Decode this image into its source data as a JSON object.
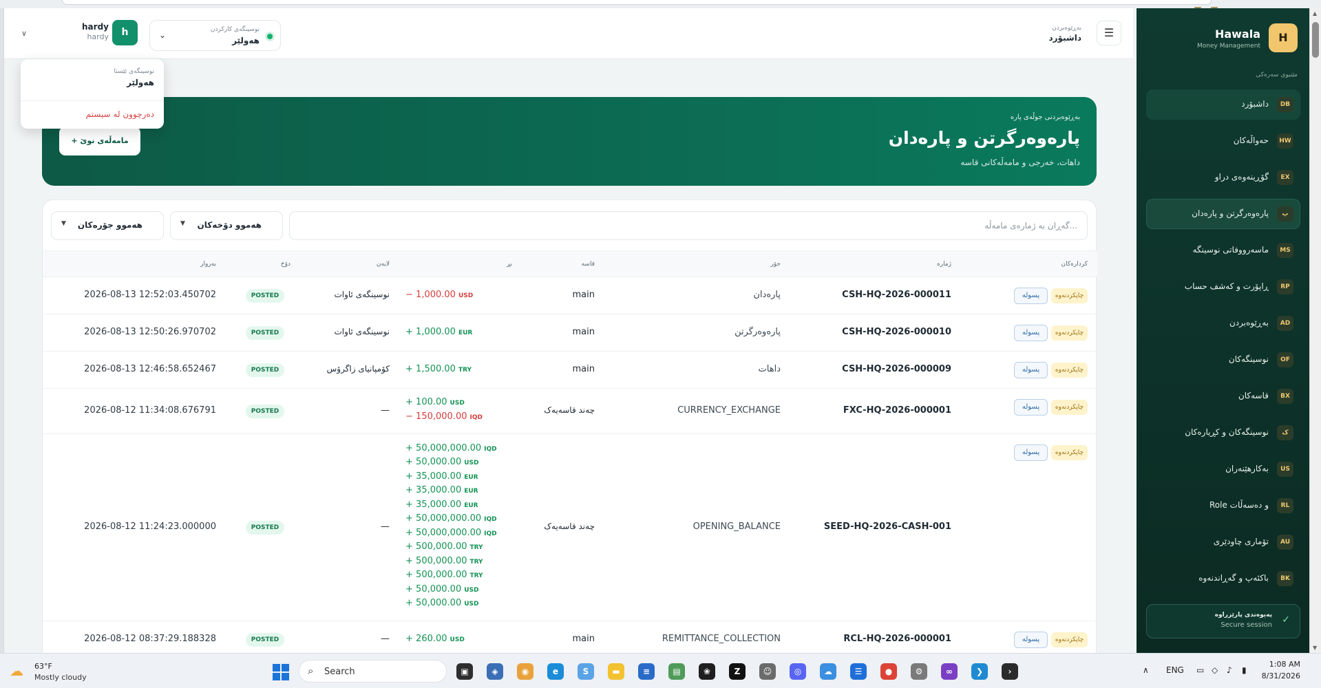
{
  "header": {
    "user_name": "hardy",
    "user_sub": "hardy",
    "user_initial": "h",
    "office_label": "نوسینگەی کارکردن",
    "office_value": "هەولێر",
    "crumb_top": "بەڕێوەبردن",
    "crumb_title": "داشبۆرد"
  },
  "dropdown": {
    "office_label": "نوسینگەی ئێستا",
    "office_value": "هەولێر",
    "logout": "دەرچوون لە سیستم"
  },
  "hero": {
    "kicker": "بەڕێوەبردنی جوڵەی پارە",
    "title": "پارەوەرگرتن و پارەدان",
    "subtitle": "داهات، خەرجی و مامەڵەکانی قاسە",
    "new_button": "+  مامەڵەی نوێ"
  },
  "filters": {
    "search_placeholder": "گەڕان بە ژمارەی مامەڵە...",
    "filter_types": "هەموو دۆخەکان",
    "filter_kinds": "هەموو جۆرەکان"
  },
  "table": {
    "headers": {
      "actions": "کردارەکان",
      "number": "ژمارە",
      "type": "جۆر",
      "cashbox": "قاسە",
      "amount": "بڕ",
      "party": "لایەن",
      "status": "دۆخ",
      "date": "بەروار"
    },
    "posting_label": "پسولە",
    "print_label": "چاپکردنەوە",
    "rows": [
      {
        "ref": "CSH-HQ-2026-000011",
        "type": "پارەدان",
        "cashbox": "main",
        "amounts": [
          {
            "sign": "−",
            "value": "1,000.00",
            "cur": "USD",
            "neg": true
          }
        ],
        "party": "نوسینگەی ئاوات",
        "status": "POSTED",
        "date": "2026-08-13 12:52:03.450702"
      },
      {
        "ref": "CSH-HQ-2026-000010",
        "type": "پارەوەرگرتن",
        "cashbox": "main",
        "amounts": [
          {
            "sign": "+",
            "value": "1,000.00",
            "cur": "EUR",
            "neg": false
          }
        ],
        "party": "نوسینگەی ئاوات",
        "status": "POSTED",
        "date": "2026-08-13 12:50:26.970702"
      },
      {
        "ref": "CSH-HQ-2026-000009",
        "type": "داهات",
        "cashbox": "main",
        "amounts": [
          {
            "sign": "+",
            "value": "1,500.00",
            "cur": "TRY",
            "neg": false
          }
        ],
        "party": "کۆمپانیای زاگرۆس",
        "status": "POSTED",
        "date": "2026-08-13 12:46:58.652467"
      },
      {
        "ref": "FXC-HQ-2026-000001",
        "type": "CURRENCY_EXCHANGE",
        "cashbox": "چەند قاسەیەک",
        "amounts": [
          {
            "sign": "+",
            "value": "100.00",
            "cur": "USD",
            "neg": false
          },
          {
            "sign": "−",
            "value": "150,000.00",
            "cur": "IQD",
            "neg": true
          }
        ],
        "party": "—",
        "status": "POSTED",
        "date": "2026-08-12 11:34:08.676791"
      },
      {
        "ref": "SEED-HQ-2026-CASH-001",
        "type": "OPENING_BALANCE",
        "cashbox": "چەند قاسەیەک",
        "amounts": [
          {
            "sign": "+",
            "value": "50,000,000.00",
            "cur": "IQD",
            "neg": false
          },
          {
            "sign": "+",
            "value": "50,000.00",
            "cur": "USD",
            "neg": false
          },
          {
            "sign": "+",
            "value": "35,000.00",
            "cur": "EUR",
            "neg": false
          },
          {
            "sign": "+",
            "value": "35,000.00",
            "cur": "EUR",
            "neg": false
          },
          {
            "sign": "+",
            "value": "35,000.00",
            "cur": "EUR",
            "neg": false
          },
          {
            "sign": "+",
            "value": "50,000,000.00",
            "cur": "IQD",
            "neg": false
          },
          {
            "sign": "+",
            "value": "50,000,000.00",
            "cur": "IQD",
            "neg": false
          },
          {
            "sign": "+",
            "value": "500,000.00",
            "cur": "TRY",
            "neg": false
          },
          {
            "sign": "+",
            "value": "500,000.00",
            "cur": "TRY",
            "neg": false
          },
          {
            "sign": "+",
            "value": "500,000.00",
            "cur": "TRY",
            "neg": false
          },
          {
            "sign": "+",
            "value": "50,000.00",
            "cur": "USD",
            "neg": false
          },
          {
            "sign": "+",
            "value": "50,000.00",
            "cur": "USD",
            "neg": false
          }
        ],
        "party": "—",
        "status": "POSTED",
        "date": "2026-08-12 11:24:23.000000"
      },
      {
        "ref": "RCL-HQ-2026-000001",
        "type": "REMITTANCE_COLLECTION",
        "cashbox": "main",
        "amounts": [
          {
            "sign": "+",
            "value": "260.00",
            "cur": "USD",
            "neg": false
          }
        ],
        "party": "—",
        "status": "POSTED",
        "date": "2026-08-12 08:37:29.188328"
      }
    ]
  },
  "sidebar": {
    "logo_letter": "H",
    "title": "Hawala",
    "subtitle": "Money Management",
    "section": "مێنیوی سەرەکی",
    "items": [
      {
        "badge": "DB",
        "label": "داشبۆرد"
      },
      {
        "badge": "HW",
        "label": "حەواڵەکان"
      },
      {
        "badge": "EX",
        "label": "گۆڕینەوەی دراو"
      },
      {
        "badge": "پ",
        "label": "پارەوەرگرتن و پارەدان"
      },
      {
        "badge": "MS",
        "label": "ماسەرووفاتی نوسینگە"
      },
      {
        "badge": "RP",
        "label": "ڕاپۆرت و کەشف حساب"
      },
      {
        "badge": "AD",
        "label": "بەڕێوەبردن"
      },
      {
        "badge": "OF",
        "label": "نوسینگەکان"
      },
      {
        "badge": "BX",
        "label": "قاسەکان"
      },
      {
        "badge": "ک",
        "label": "نوسینگەکان و کڕیارەکان"
      },
      {
        "badge": "US",
        "label": "بەکارهێنەران"
      },
      {
        "badge": "RL",
        "label": "Role و دەسەڵات"
      },
      {
        "badge": "AU",
        "label": "تۆماری چاودێری"
      },
      {
        "badge": "BK",
        "label": "باکئەپ و گەڕاندنەوە"
      }
    ],
    "secure_title": "پەیوەندی پارێزراوە",
    "secure_sub": "Secure session"
  },
  "taskbar": {
    "temp": "63°F",
    "weather": "Mostly cloudy",
    "search_label": "Search",
    "lang": "ENG",
    "time": "1:08 AM",
    "date": "8/31/2026"
  }
}
